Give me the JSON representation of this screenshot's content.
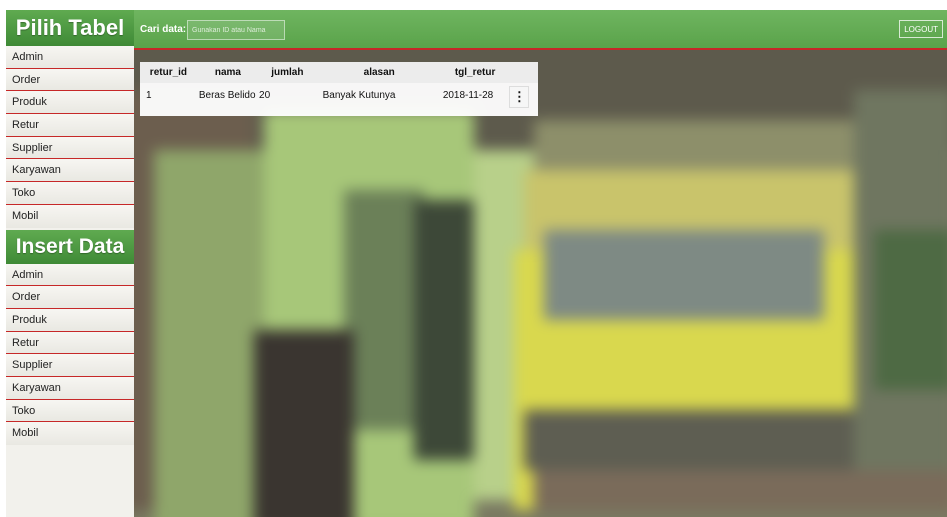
{
  "sidebar": {
    "pilih_title": "Pilih Tabel",
    "pilih_items": [
      "Admin",
      "Order",
      "Produk",
      "Retur",
      "Supplier",
      "Karyawan",
      "Toko",
      "Mobil"
    ],
    "insert_title": "Insert Data",
    "insert_items": [
      "Admin",
      "Order",
      "Produk",
      "Retur",
      "Supplier",
      "Karyawan",
      "Toko",
      "Mobil"
    ]
  },
  "topbar": {
    "search_label": "Cari data:",
    "search_placeholder": "Gunakan ID atau Nama",
    "search_value": "",
    "logout_label": "LOGOUT"
  },
  "table": {
    "headers": [
      "retur_id",
      "nama",
      "jumlah",
      "alasan",
      "tgl_retur"
    ],
    "rows": [
      {
        "retur_id": "1",
        "nama": "Beras Belido",
        "jumlah": "20",
        "alasan": "Banyak Kutunya",
        "tgl_retur": "2018-11-28",
        "action": "⋮"
      }
    ]
  },
  "colors": {
    "header_green": "#5aa34a",
    "accent_red": "#c62828",
    "sidebar_bg": "#f2f1ec"
  }
}
